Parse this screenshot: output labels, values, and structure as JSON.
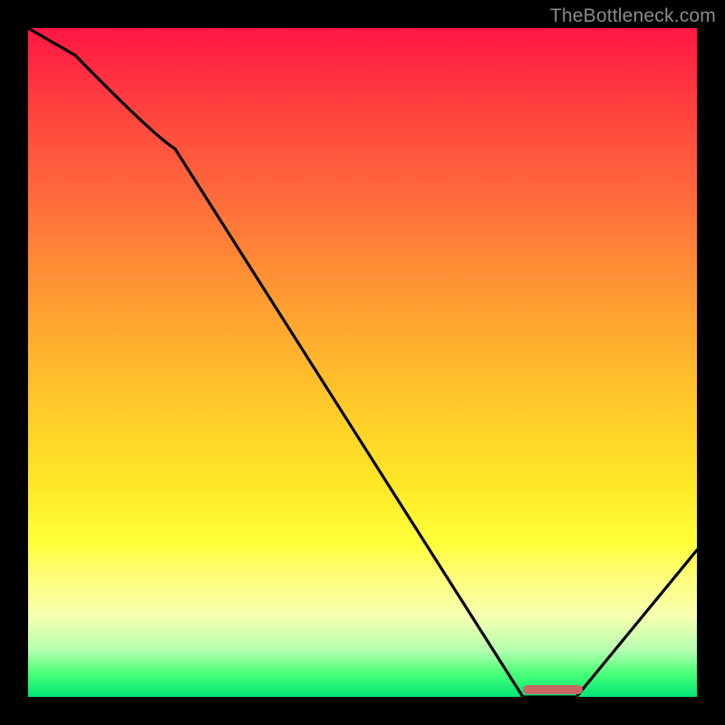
{
  "watermark": "TheBottleneck.com",
  "chart_data": {
    "type": "line",
    "title": "",
    "xlabel": "",
    "ylabel": "",
    "xlim": [
      0,
      100
    ],
    "ylim": [
      0,
      100
    ],
    "series": [
      {
        "name": "curve",
        "x": [
          0,
          7,
          22,
          74,
          82,
          100
        ],
        "values": [
          100,
          96,
          82,
          0,
          0,
          22
        ]
      }
    ],
    "marker": {
      "x_start": 74,
      "x_end": 82,
      "y": 0,
      "color": "#cc6666"
    },
    "colors": {
      "background_gradient_top": "#ff1744",
      "background_gradient_bottom": "#00e676",
      "curve": "#000000",
      "frame": "#000000"
    }
  }
}
